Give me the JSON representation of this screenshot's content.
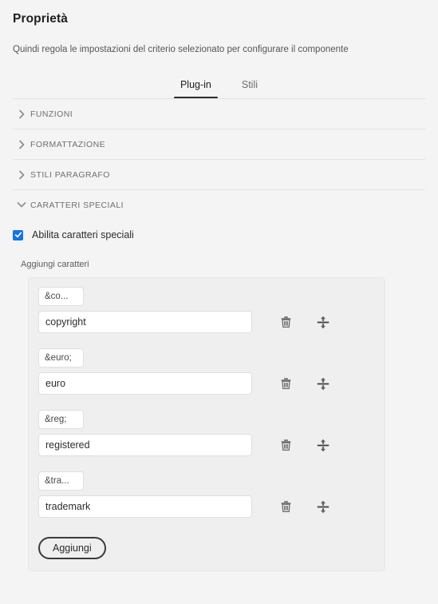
{
  "header": {
    "title": "Proprietà",
    "subtitle": "Quindi regola le impostazioni del criterio selezionato per configurare il componente"
  },
  "tabs": [
    {
      "label": "Plug-in",
      "active": true
    },
    {
      "label": "Stili",
      "active": false
    }
  ],
  "accordion": [
    {
      "label": "FUNZIONI",
      "expanded": false,
      "icon": "chevron-right-icon"
    },
    {
      "label": "FORMATTAZIONE",
      "expanded": false,
      "icon": "chevron-right-icon"
    },
    {
      "label": "STILI PARAGRAFO",
      "expanded": false,
      "icon": "chevron-right-icon"
    },
    {
      "label": "CARATTERI SPECIALI",
      "expanded": true,
      "icon": "chevron-down-icon"
    }
  ],
  "special_characters": {
    "checkbox": {
      "label": "Abilita caratteri speciali",
      "checked": true,
      "color": "#1473e6"
    },
    "group_label": "Aggiungi caratteri",
    "entries": [
      {
        "entity": "&co...",
        "name": "copyright"
      },
      {
        "entity": "&euro;",
        "name": "euro"
      },
      {
        "entity": "&reg;",
        "name": "registered"
      },
      {
        "entity": "&tra...",
        "name": "trademark"
      }
    ],
    "row_icons": {
      "delete": "trash-icon",
      "reorder": "move-vertical-icon"
    },
    "add_button": "Aggiungi"
  }
}
